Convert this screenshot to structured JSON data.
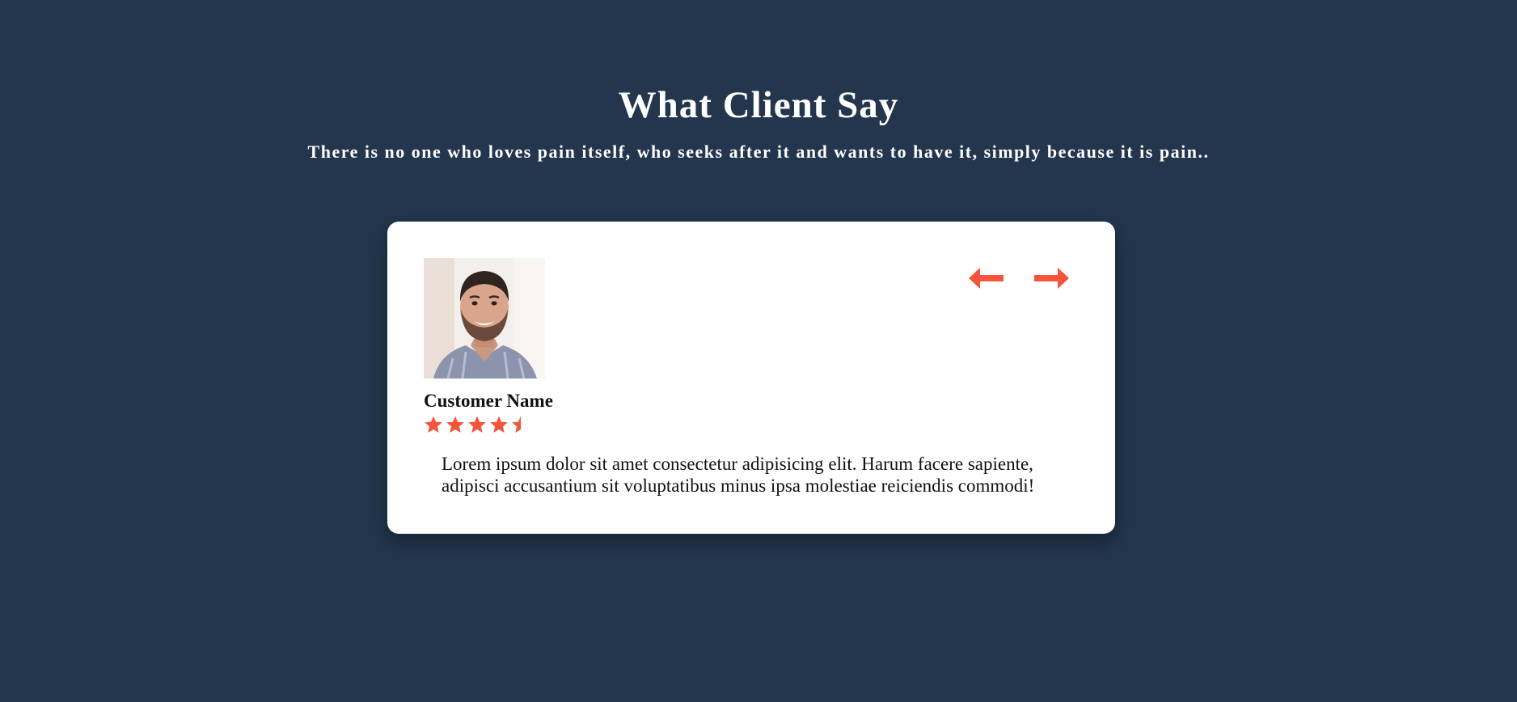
{
  "section": {
    "title": "What Client Say",
    "subtitle": "There is no one who loves pain itself, who seeks after it and wants to have it, simply because it is pain.."
  },
  "testimonial": {
    "customer_name": "Customer Name",
    "rating": 4.5,
    "rating_max": 5,
    "text": "Lorem ipsum dolor sit amet consectetur adipisicing elit. Harum facere sapiente, adipisci accusantium sit voluptatibus minus ipsa molestiae reiciendis commodi!"
  },
  "navigation": {
    "prev_icon": "arrow-left-icon",
    "next_icon": "arrow-right-icon"
  },
  "colors": {
    "background": "#23364d",
    "card": "#ffffff",
    "accent": "#f2553b",
    "text": "#111111"
  }
}
